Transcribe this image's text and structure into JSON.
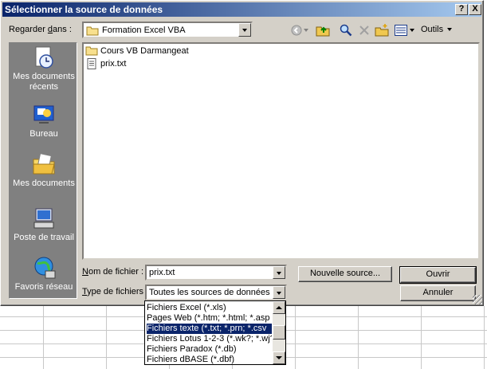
{
  "window": {
    "title": "Sélectionner la source de données",
    "help_label": "?",
    "close_label": "X"
  },
  "lookin": {
    "label_pre": "Regarder ",
    "label_u": "d",
    "label_post": "ans :",
    "value": "Formation Excel VBA"
  },
  "toolbar": {
    "tools_label": "Outils"
  },
  "places": [
    {
      "label": "Mes documents récents",
      "icon": "recent-documents-icon"
    },
    {
      "label": "Bureau",
      "icon": "desktop-icon"
    },
    {
      "label": "Mes documents",
      "icon": "my-documents-icon"
    },
    {
      "label": "Poste de travail",
      "icon": "my-computer-icon"
    },
    {
      "label": "Favoris réseau",
      "icon": "network-places-icon"
    }
  ],
  "files": [
    {
      "name": "Cours VB Darmangeat",
      "icon": "folder-icon"
    },
    {
      "name": "prix.txt",
      "icon": "text-file-icon"
    }
  ],
  "filename": {
    "label_u": "N",
    "label_post": "om de fichier :",
    "value": "prix.txt"
  },
  "filetype": {
    "label_u": "T",
    "label_post": "ype de fichiers :",
    "value": "Toutes les sources de données (*"
  },
  "buttons": {
    "new_source": "Nouvelle source...",
    "open": "Ouvrir",
    "cancel": "Annuler"
  },
  "dropdown_options": [
    "Fichiers Excel (*.xls)",
    "Pages Web (*.htm; *.html; *.asp",
    "Fichiers texte (*.txt; *.prn; *.csv",
    "Fichiers Lotus 1-2-3 (*.wk?; *.wj?",
    "Fichiers Paradox (*.db)",
    "Fichiers dBASE (*.dbf)"
  ],
  "dropdown_selected_index": 2
}
